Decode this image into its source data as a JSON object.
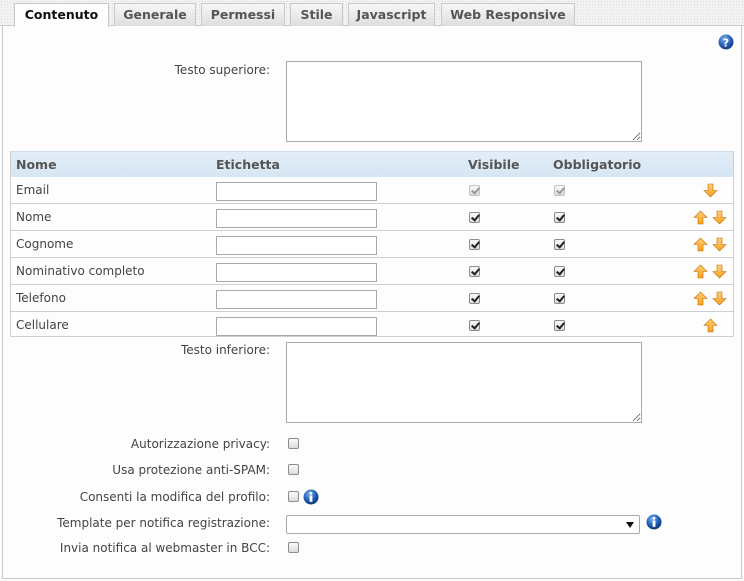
{
  "tabs": [
    {
      "label": "Contenuto",
      "active": true
    },
    {
      "label": "Generale",
      "active": false
    },
    {
      "label": "Permessi",
      "active": false
    },
    {
      "label": "Stile",
      "active": false
    },
    {
      "label": "Javascript",
      "active": false
    },
    {
      "label": "Web Responsive",
      "active": false
    }
  ],
  "help_icon": "help-icon",
  "top_text": {
    "label": "Testo superiore:",
    "value": ""
  },
  "fields_table": {
    "headers": {
      "name": "Nome",
      "label": "Etichetta",
      "visible": "Visibile",
      "required": "Obbligatorio"
    },
    "rows": [
      {
        "name": "Email",
        "label_value": "",
        "visible": true,
        "required": true,
        "disabled": true,
        "up": false,
        "down": true
      },
      {
        "name": "Nome",
        "label_value": "",
        "visible": true,
        "required": true,
        "disabled": false,
        "up": true,
        "down": true
      },
      {
        "name": "Cognome",
        "label_value": "",
        "visible": true,
        "required": true,
        "disabled": false,
        "up": true,
        "down": true
      },
      {
        "name": "Nominativo completo",
        "label_value": "",
        "visible": true,
        "required": true,
        "disabled": false,
        "up": true,
        "down": true
      },
      {
        "name": "Telefono",
        "label_value": "",
        "visible": true,
        "required": true,
        "disabled": false,
        "up": true,
        "down": true
      },
      {
        "name": "Cellulare",
        "label_value": "",
        "visible": true,
        "required": true,
        "disabled": false,
        "up": true,
        "down": false
      }
    ]
  },
  "bottom_text": {
    "label": "Testo inferiore:",
    "value": ""
  },
  "options": {
    "privacy": {
      "label": "Autorizzazione privacy:",
      "checked": false
    },
    "antispam": {
      "label": "Usa protezione anti-SPAM:",
      "checked": false
    },
    "profile_edit": {
      "label": "Consenti la modifica del profilo:",
      "checked": false,
      "info_icon": "info-icon"
    },
    "notify_template": {
      "label": "Template per notifica registrazione:",
      "selected": "",
      "info_icon": "info-icon"
    },
    "bcc": {
      "label": "Invia notifica al webmaster in BCC:",
      "checked": false
    }
  },
  "colors": {
    "arrow_fill": "#f7a21b",
    "table_header_bg": "#dbe8f5",
    "info_blue": "#1d5fb8"
  }
}
